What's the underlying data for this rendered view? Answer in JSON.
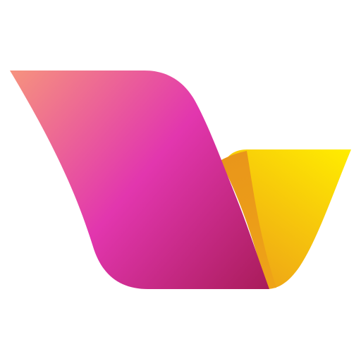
{
  "logo": {
    "icon": "v-ribbon-logo-icon",
    "colors": {
      "background": "#ffffff",
      "magenta_light": "#F6937E",
      "magenta_mid": "#E236AE",
      "magenta_dark": "#A91C5A",
      "yellow_light": "#FFEC00",
      "yellow_dark": "#EEA317",
      "fold_orange": "#E9961A"
    }
  }
}
